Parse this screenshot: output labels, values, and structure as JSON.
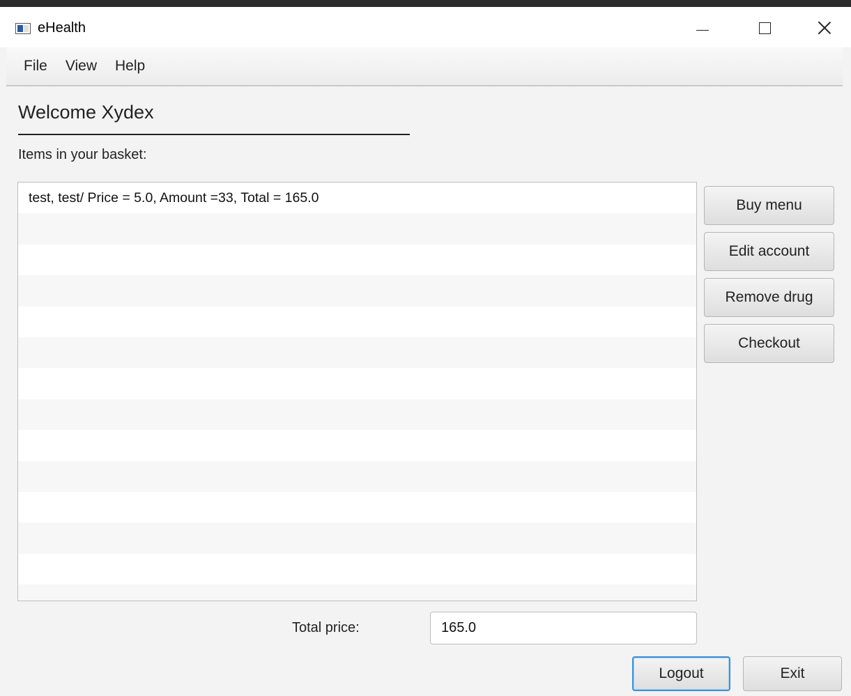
{
  "window": {
    "title": "eHealth"
  },
  "menu": {
    "items": [
      {
        "label": "File"
      },
      {
        "label": "View"
      },
      {
        "label": "Help"
      }
    ]
  },
  "main": {
    "welcome": "Welcome Xydex",
    "basket_label": "Items in your basket:",
    "basket_items": [
      "test, test/ Price = 5.0, Amount =33, Total = 165.0"
    ],
    "total_label": "Total price:",
    "total_value": "165.0"
  },
  "side_buttons": {
    "buy_menu": "Buy menu",
    "edit_account": "Edit account",
    "remove_drug": "Remove drug",
    "checkout": "Checkout"
  },
  "bottom_buttons": {
    "logout": "Logout",
    "exit": "Exit"
  },
  "colors": {
    "focus_ring": "#3d8fd6",
    "window_bg": "#f3f3f3",
    "background_strip_text": "#5fb35f"
  }
}
